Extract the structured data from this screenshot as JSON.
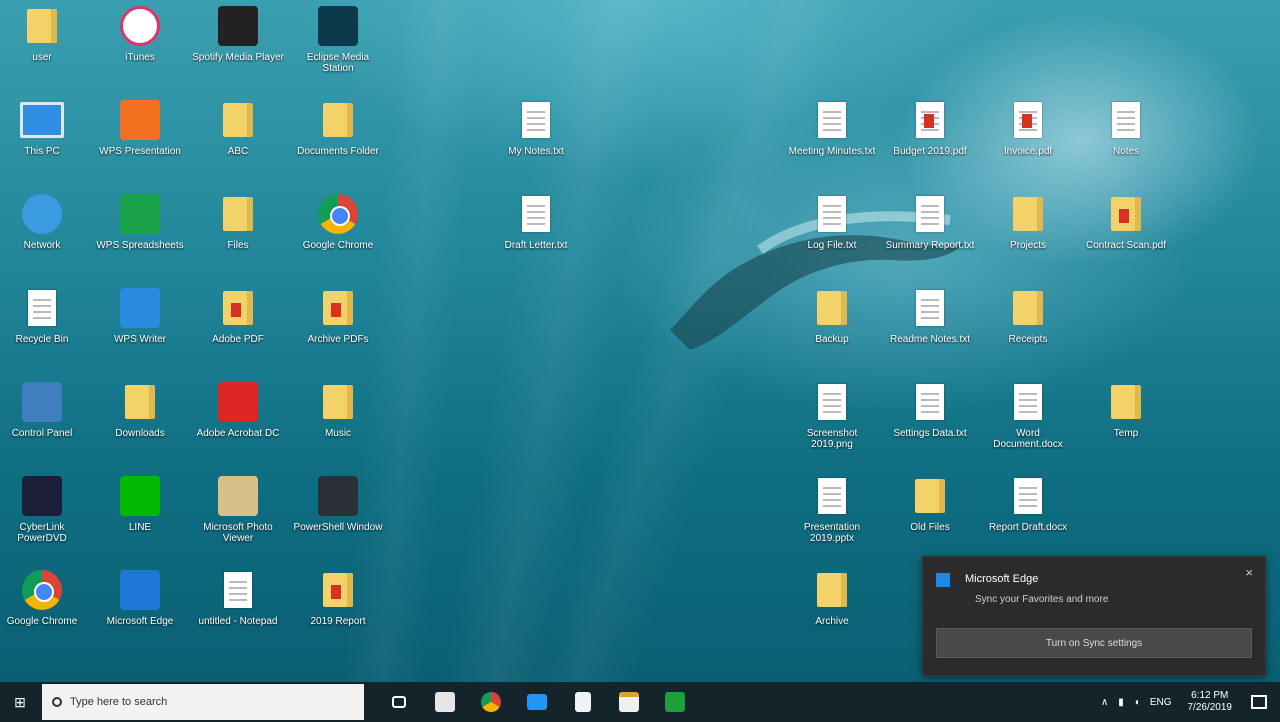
{
  "desktop": {
    "icons": [
      {
        "label": "user",
        "icon": "folder-person-icon"
      },
      {
        "label": "iTunes",
        "icon": "itunes-icon"
      },
      {
        "label": "Spotify Media Player",
        "icon": "media-app-icon"
      },
      {
        "label": "Eclipse Media Station",
        "icon": "video-app-icon"
      },
      {
        "label": "This PC",
        "icon": "computer-icon"
      },
      {
        "label": "WPS Presentation",
        "icon": "wps-presentation-icon"
      },
      {
        "label": "ABC",
        "icon": "folder-icon"
      },
      {
        "label": "Documents Folder",
        "icon": "folder-icon"
      },
      {
        "label": "Network",
        "icon": "network-icon"
      },
      {
        "label": "WPS Spreadsheets",
        "icon": "wps-spreadsheets-icon"
      },
      {
        "label": "Files",
        "icon": "folder-icon"
      },
      {
        "label": "Google Chrome",
        "icon": "chrome-icon"
      },
      {
        "label": "Recycle Bin",
        "icon": "recycle-bin-icon"
      },
      {
        "label": "WPS Writer",
        "icon": "wps-writer-icon"
      },
      {
        "label": "Adobe PDF",
        "icon": "pdf-folder-icon"
      },
      {
        "label": "Archive PDFs",
        "icon": "pdf-folder-icon"
      },
      {
        "label": "Control Panel",
        "icon": "control-panel-icon"
      },
      {
        "label": "Downloads",
        "icon": "folder-icon"
      },
      {
        "label": "Adobe Acrobat DC",
        "icon": "acrobat-icon"
      },
      {
        "label": "Music",
        "icon": "folder-icon"
      },
      {
        "label": "CyberLink PowerDVD",
        "icon": "powerdvd-icon"
      },
      {
        "label": "LINE",
        "icon": "line-icon"
      },
      {
        "label": "Microsoft Photo Viewer",
        "icon": "photos-icon"
      },
      {
        "label": "PowerShell Window",
        "icon": "powershell-icon"
      },
      {
        "label": "Google Chrome",
        "icon": "chrome-icon"
      },
      {
        "label": "Microsoft Edge",
        "icon": "edge-icon"
      },
      {
        "label": "untitled - Notepad",
        "icon": "document-icon"
      },
      {
        "label": "2019 Report",
        "icon": "pdf-folder-icon"
      }
    ],
    "files": [
      {
        "label": "My Notes.txt",
        "icon": "text-file-icon"
      },
      {
        "label": "Draft Letter.txt",
        "icon": "text-file-icon"
      },
      {
        "label": "Meeting Minutes.txt",
        "icon": "text-file-icon"
      },
      {
        "label": "Budget 2019.pdf",
        "icon": "pdf-file-icon"
      },
      {
        "label": "Invoice.pdf",
        "icon": "pdf-file-icon"
      },
      {
        "label": "Notes",
        "icon": "text-file-icon"
      },
      {
        "label": "Log File.txt",
        "icon": "text-file-icon"
      },
      {
        "label": "Summary Report.txt",
        "icon": "text-file-icon"
      },
      {
        "label": "Projects",
        "icon": "folder-icon"
      },
      {
        "label": "Contract Scan.pdf",
        "icon": "pdf-folder-icon"
      },
      {
        "label": "Backup",
        "icon": "folder-icon"
      },
      {
        "label": "Readme Notes.txt",
        "icon": "text-file-icon"
      },
      {
        "label": "Receipts",
        "icon": "folder-icon"
      },
      {
        "label": "Screenshot 2019.png",
        "icon": "image-file-icon"
      },
      {
        "label": "Settings Data.txt",
        "icon": "text-file-icon"
      },
      {
        "label": "Word Document.docx",
        "icon": "word-file-icon"
      },
      {
        "label": "Temp",
        "icon": "folder-icon"
      },
      {
        "label": "Presentation 2019.pptx",
        "icon": "image-file-icon"
      },
      {
        "label": "Old Files",
        "icon": "folder-icon"
      },
      {
        "label": "Report Draft.docx",
        "icon": "word-file-icon"
      },
      {
        "label": "Archive",
        "icon": "folder-icon"
      }
    ]
  },
  "toast": {
    "title": "Microsoft Edge",
    "body": "Sync your Favorites and more",
    "action": "Turn on Sync settings",
    "close": "×"
  },
  "taskbar": {
    "start": "⊞",
    "search_placeholder": "Type here to search",
    "apps": [
      "task-view",
      "media-player",
      "chrome",
      "file-explorer",
      "notepad",
      "store",
      "excel"
    ],
    "tray_text": "ENG",
    "time": "6:12 PM",
    "date": "7/26/2019"
  },
  "colors": {
    "taskbar_bg": "#15242b",
    "toast_bg": "#2b2b2b",
    "accent": "#1e88e5"
  }
}
